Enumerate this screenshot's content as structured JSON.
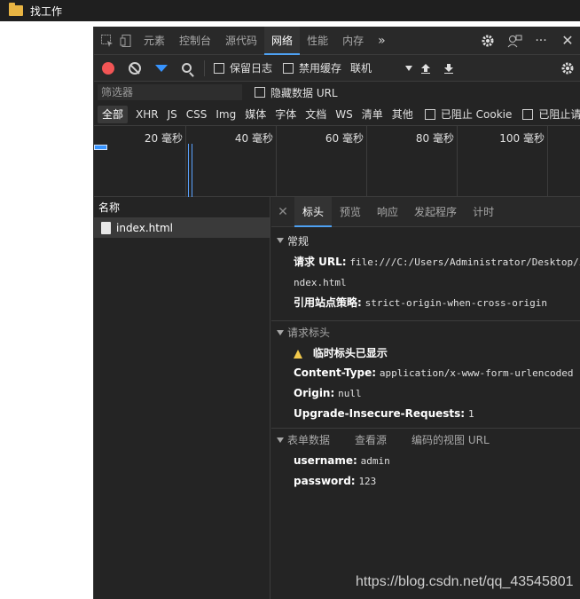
{
  "window": {
    "title": "找工作"
  },
  "tabs": {
    "items": [
      "元素",
      "控制台",
      "源代码",
      "网络",
      "性能",
      "内存"
    ],
    "more": "»",
    "active": "网络"
  },
  "network_toolbar": {
    "preserve_log": "保留日志",
    "disable_cache": "禁用缓存",
    "throttle": "联机"
  },
  "filter": {
    "placeholder": "筛选器",
    "hide_data_urls": "隐藏数据 URL"
  },
  "type_filters": [
    "全部",
    "XHR",
    "JS",
    "CSS",
    "Img",
    "媒体",
    "字体",
    "文档",
    "WS",
    "清单",
    "其他"
  ],
  "type_extra": {
    "blocked_cookies": "已阻止 Cookie",
    "blocked_requests": "已阻止请求"
  },
  "timeline": {
    "ticks": [
      "20 毫秒",
      "40 毫秒",
      "60 毫秒",
      "80 毫秒",
      "100 毫秒"
    ]
  },
  "request_list": {
    "header": "名称",
    "rows": [
      "index.html"
    ]
  },
  "detail": {
    "tabs": [
      "标头",
      "预览",
      "响应",
      "发起程序",
      "计时"
    ],
    "general": {
      "title": "常规",
      "request_url_key": "请求 URL:",
      "request_url_line1": "file:///C:/Users/Administrator/Desktop/i",
      "request_url_line2": "ndex.html",
      "referrer_key": "引用站点策略:",
      "referrer_val": "strict-origin-when-cross-origin"
    },
    "request_headers": {
      "title": "请求标头",
      "warning": "临时标头已显示",
      "content_type_key": "Content-Type:",
      "content_type_val": "application/x-www-form-urlencoded",
      "origin_key": "Origin:",
      "origin_val": "null",
      "uir_key": "Upgrade-Insecure-Requests:",
      "uir_val": "1"
    },
    "form_data": {
      "title": "表单数据",
      "view_source": "查看源",
      "view_url": "编码的视图 URL",
      "username_key": "username:",
      "username_val": "admin",
      "password_key": "password:",
      "password_val": "123"
    }
  },
  "watermark": "https://blog.csdn.net/qq_43545801",
  "colors": {
    "accent": "#3794ff",
    "record": "#f25555",
    "warning": "#f2c94c"
  }
}
